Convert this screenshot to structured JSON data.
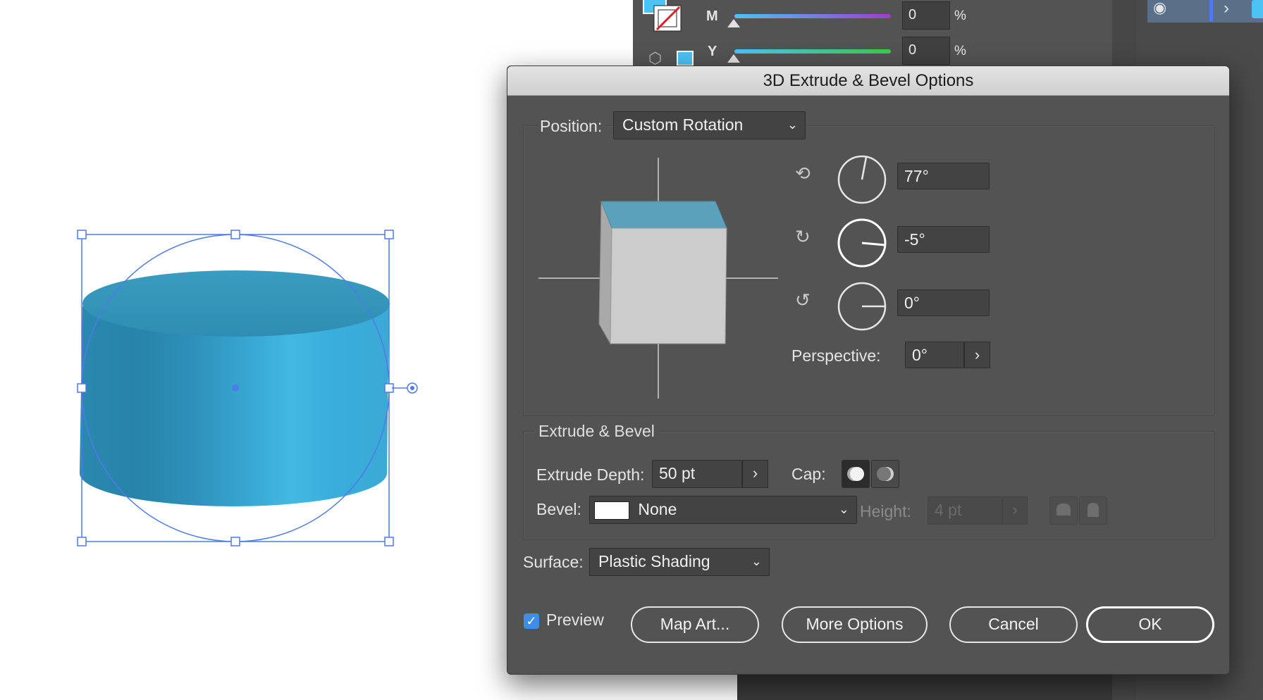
{
  "color_panel": {
    "channels": [
      {
        "label": "M",
        "value": "0",
        "unit": "%",
        "level": 0
      },
      {
        "label": "Y",
        "value": "0",
        "unit": "%",
        "level": 0
      }
    ],
    "fill_color": "#4cc3f5"
  },
  "dialog": {
    "title": "3D Extrude & Bevel Options",
    "position": {
      "label": "Position:",
      "value": "Custom Rotation",
      "x_rotation": "77°",
      "y_rotation": "-5°",
      "z_rotation": "0°",
      "perspective_label": "Perspective:",
      "perspective": "0°"
    },
    "extrude": {
      "legend": "Extrude & Bevel",
      "depth_label": "Extrude Depth:",
      "depth": "50 pt",
      "cap_label": "Cap:",
      "bevel_label": "Bevel:",
      "bevel": "None",
      "height_label": "Height:",
      "height": "4 pt"
    },
    "surface": {
      "label": "Surface:",
      "value": "Plastic Shading"
    },
    "buttons": {
      "preview": "Preview",
      "map_art": "Map Art...",
      "more_options": "More Options",
      "cancel": "Cancel",
      "ok": "OK"
    },
    "preview_checked": true
  },
  "colors": {
    "accent": "#3d8ee8",
    "cylinder": "#3aa6cf",
    "selection": "#4f7be8"
  }
}
